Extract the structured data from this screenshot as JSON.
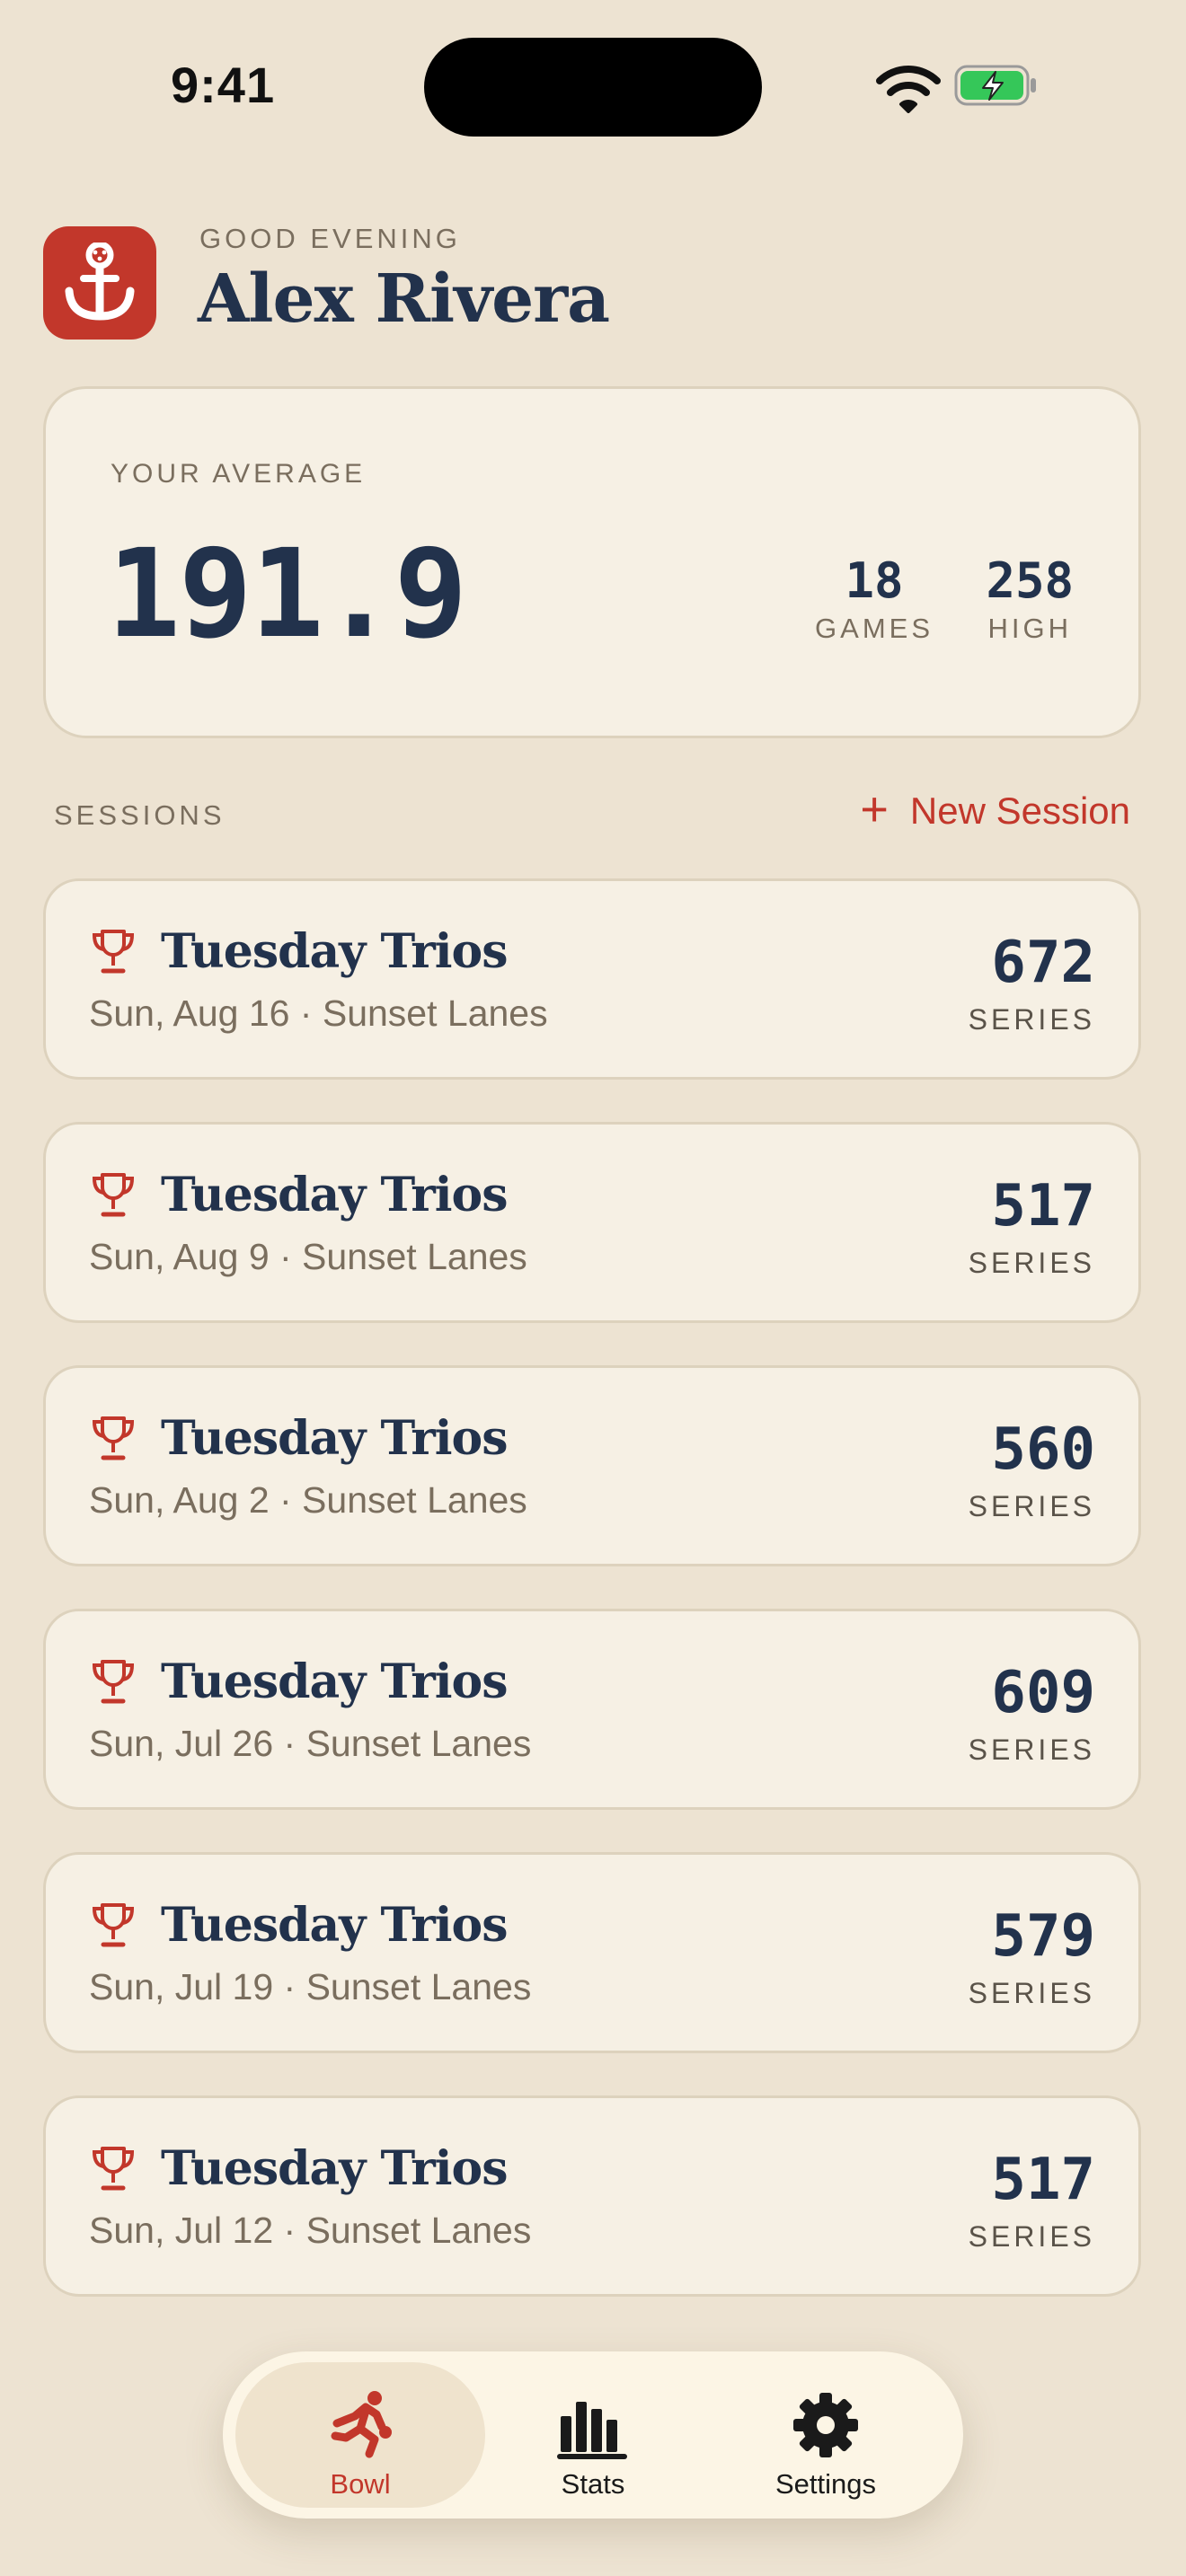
{
  "status_bar": {
    "time": "9:41"
  },
  "header": {
    "greeting": "GOOD EVENING",
    "user_name": "Alex Rivera"
  },
  "average_card": {
    "label": "YOUR AVERAGE",
    "value": "191.9",
    "games_count": "18",
    "games_label": "GAMES",
    "high_value": "258",
    "high_label": "HIGH"
  },
  "sessions": {
    "section_label": "SESSIONS",
    "new_session_label": "New Session",
    "items": [
      {
        "title": "Tuesday Trios",
        "subtitle": "Sun, Aug 16 · Sunset Lanes",
        "series": "672",
        "series_label": "SERIES"
      },
      {
        "title": "Tuesday Trios",
        "subtitle": "Sun, Aug 9 · Sunset Lanes",
        "series": "517",
        "series_label": "SERIES"
      },
      {
        "title": "Tuesday Trios",
        "subtitle": "Sun, Aug 2 · Sunset Lanes",
        "series": "560",
        "series_label": "SERIES"
      },
      {
        "title": "Tuesday Trios",
        "subtitle": "Sun, Jul 26 · Sunset Lanes",
        "series": "609",
        "series_label": "SERIES"
      },
      {
        "title": "Tuesday Trios",
        "subtitle": "Sun, Jul 19 · Sunset Lanes",
        "series": "579",
        "series_label": "SERIES"
      },
      {
        "title": "Tuesday Trios",
        "subtitle": "Sun, Jul 12 · Sunset Lanes",
        "series": "517",
        "series_label": "SERIES"
      }
    ]
  },
  "tab_bar": {
    "tabs": [
      {
        "label": "Bowl",
        "icon": "bowler-icon",
        "active": true
      },
      {
        "label": "Stats",
        "icon": "bar-chart-icon",
        "active": false
      },
      {
        "label": "Settings",
        "icon": "gear-icon",
        "active": false
      }
    ]
  },
  "colors": {
    "background": "#EDE3D2",
    "card": "#F6F0E4",
    "accent": "#C2372B",
    "navy": "#22324C",
    "muted": "#7A6E5E"
  }
}
